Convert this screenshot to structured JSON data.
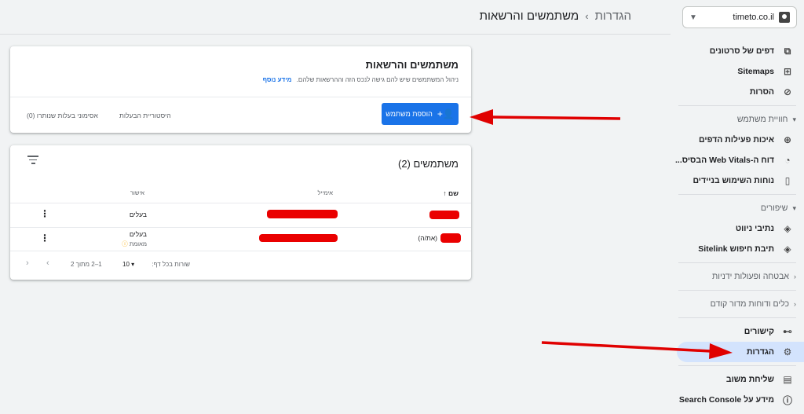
{
  "header": {
    "breadcrumb_settings": "הגדרות",
    "breadcrumb_sep": "›",
    "page_title": "משתמשים והרשאות"
  },
  "property": {
    "name": "timeto.co.il"
  },
  "sidebar": {
    "items_top": [
      {
        "label": "דפים של סרטונים",
        "icon": "video-page-icon"
      },
      {
        "label": "Sitemaps",
        "icon": "sitemap-icon"
      },
      {
        "label": "הסרות",
        "icon": "removal-icon"
      }
    ],
    "section_experience": "חוויית משתמש",
    "items_experience": [
      {
        "label": "איכות פעילות הדפים",
        "icon": "plus-circle-icon"
      },
      {
        "label": "דוח ה-Web Vitals הבסיס...",
        "icon": "gauge-icon"
      },
      {
        "label": "נוחות השימוש בניידים",
        "icon": "phone-icon"
      }
    ],
    "section_enhancements": "שיפורים",
    "items_enhancements": [
      {
        "label": "נתיבי ניווט",
        "icon": "layers-icon"
      },
      {
        "label": "תיבת חיפוש Sitelink",
        "icon": "layers-icon"
      }
    ],
    "section_security": "אבטחה ופעולות ידניות",
    "section_legacy": "כלים ודוחות מדור קודם",
    "links_label": "קישורים",
    "settings_label": "הגדרות",
    "feedback_label": "שליחת משוב",
    "about_label": "מידע על Search Console"
  },
  "card_users_permissions": {
    "title": "משתמשים והרשאות",
    "description": "ניהול המשתמשים שיש להם גישה לנכס הזה וההרשאות שלהם.",
    "learn_more": "מידע נוסף",
    "add_user": "הוספת משתמש",
    "ownership_history": "היסטוריית הבעלות",
    "unverified_owners": "אסימוני בעלות שנותרו (0)"
  },
  "card_users": {
    "title": "משתמשים (2)",
    "col_name": "שם",
    "col_email": "אימייל",
    "col_permission": "אישור",
    "rows": [
      {
        "name_suffix": "",
        "permission": "בעלים",
        "permission_sub": ""
      },
      {
        "name_suffix": "(את/ה)",
        "permission": "בעלים",
        "permission_sub": "מאומת"
      }
    ],
    "rows_per_page_label": "שורות בכל דף:",
    "rows_per_page_value": "10",
    "range_text": "1–2 מתוך 2"
  }
}
